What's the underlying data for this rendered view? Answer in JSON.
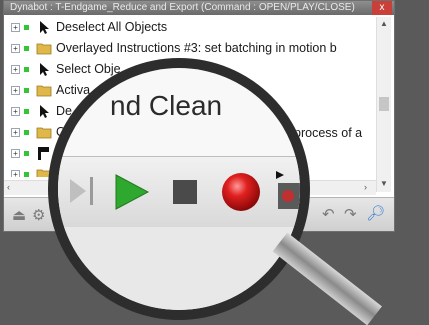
{
  "window": {
    "title": "Dynabot : T-Endgame_Reduce and Export (Command : OPEN/PLAY/CLOSE)",
    "close_label": "x"
  },
  "tree": {
    "items": [
      {
        "icon": "cursor-icon",
        "label": "Deselect All Objects"
      },
      {
        "icon": "folder-icon",
        "label": "Overlayed Instructions #3: set batching in motion b"
      },
      {
        "icon": "cursor-icon",
        "label": "Select Obje"
      },
      {
        "icon": "folder-icon",
        "label": "Activa"
      },
      {
        "icon": "cursor-icon",
        "label": "De"
      },
      {
        "icon": "folder-icon",
        "label": "O"
      },
      {
        "icon": "flag-icon",
        "label": ""
      },
      {
        "icon": "folder-icon",
        "label": ""
      }
    ],
    "partial_label_right": "process of a"
  },
  "magnifier": {
    "zoomed_text": "nd Clean",
    "controls": [
      "step-forward-icon",
      "play-icon",
      "stop-icon",
      "record-icon",
      "camera-icon"
    ]
  },
  "colors": {
    "play": "#2fa82f",
    "stop": "#4a4a4a",
    "record": "#d11616",
    "tree_dot": "#34c534"
  }
}
